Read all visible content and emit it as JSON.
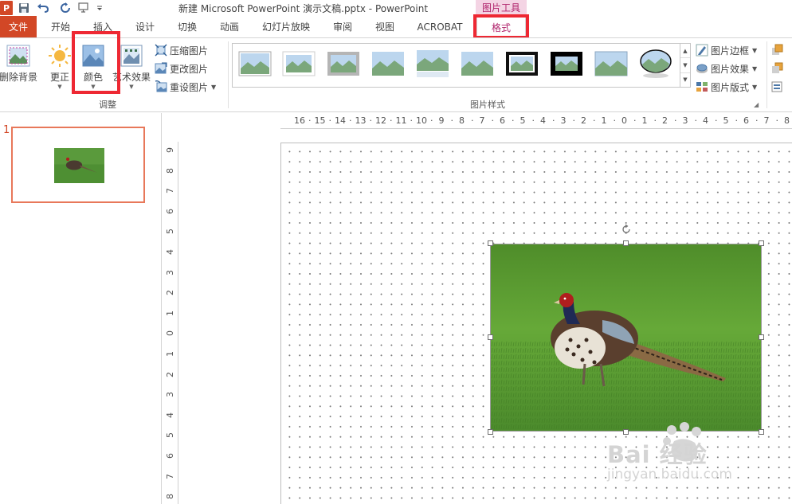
{
  "app": {
    "title": "新建 Microsoft PowerPoint 演示文稿.pptx - PowerPoint",
    "icon_letter": "P",
    "context_tab_group": "图片工具"
  },
  "tabs": {
    "file": "文件",
    "items": [
      {
        "label": "开始"
      },
      {
        "label": "插入"
      },
      {
        "label": "设计"
      },
      {
        "label": "切换"
      },
      {
        "label": "动画"
      },
      {
        "label": "幻灯片放映"
      },
      {
        "label": "审阅"
      },
      {
        "label": "视图"
      },
      {
        "label": "ACROBAT"
      },
      {
        "label": "格式",
        "active": true
      }
    ]
  },
  "ribbon": {
    "adjust": {
      "remove_bg": "删除背景",
      "corrections": "更正",
      "color": "颜色",
      "artistic": "艺术效果",
      "compress": "压缩图片",
      "change": "更改图片",
      "reset": "重设图片",
      "group_label": "调整"
    },
    "styles": {
      "group_label": "图片样式",
      "border": "图片边框",
      "effects": "图片效果",
      "layout": "图片版式"
    }
  },
  "slides": [
    {
      "number": "1"
    }
  ],
  "ruler": {
    "horizontal": [
      "16",
      "15",
      "14",
      "13",
      "12",
      "11",
      "10",
      "9",
      "8",
      "7",
      "6",
      "5",
      "4",
      "3",
      "2",
      "1",
      "0",
      "1",
      "2",
      "3",
      "4",
      "5",
      "6",
      "7",
      "8"
    ],
    "vertical": [
      "9",
      "8",
      "7",
      "6",
      "5",
      "4",
      "3",
      "2",
      "1",
      "0",
      "1",
      "2",
      "3",
      "4",
      "5",
      "6",
      "7",
      "8"
    ]
  },
  "colors": {
    "accent": "#d24726",
    "context": "#b0236b",
    "highlight": "#ee2833"
  },
  "watermark": {
    "brand": "Bai 经验",
    "url": "jingyan.baidu.com"
  }
}
